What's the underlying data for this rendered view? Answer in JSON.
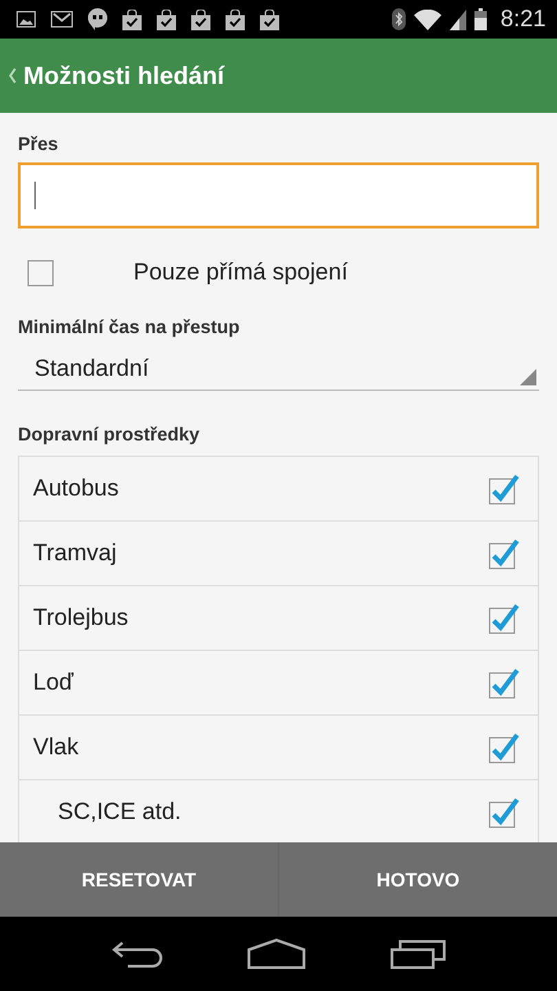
{
  "status_bar": {
    "time": "8:21"
  },
  "app_bar": {
    "title": "Možnosti hledání"
  },
  "via": {
    "label": "Přes",
    "focused": true
  },
  "direct_only": {
    "label": "Pouze přímá spojení",
    "checked": false
  },
  "transfer_time": {
    "label": "Minimální čas na přestup",
    "value": "Standardní"
  },
  "transport": {
    "label": "Dopravní prostředky",
    "items": [
      {
        "label": "Autobus",
        "checked": true,
        "kind": "main"
      },
      {
        "label": "Tramvaj",
        "checked": true,
        "kind": "main"
      },
      {
        "label": "Trolejbus",
        "checked": true,
        "kind": "main"
      },
      {
        "label": "Loď",
        "checked": true,
        "kind": "main"
      },
      {
        "label": "Vlak",
        "checked": true,
        "kind": "main"
      },
      {
        "label": "SC,ICE atd.",
        "checked": true,
        "kind": "sub"
      }
    ]
  },
  "actions": [
    "RESETOVAT",
    "HOTOVO"
  ]
}
